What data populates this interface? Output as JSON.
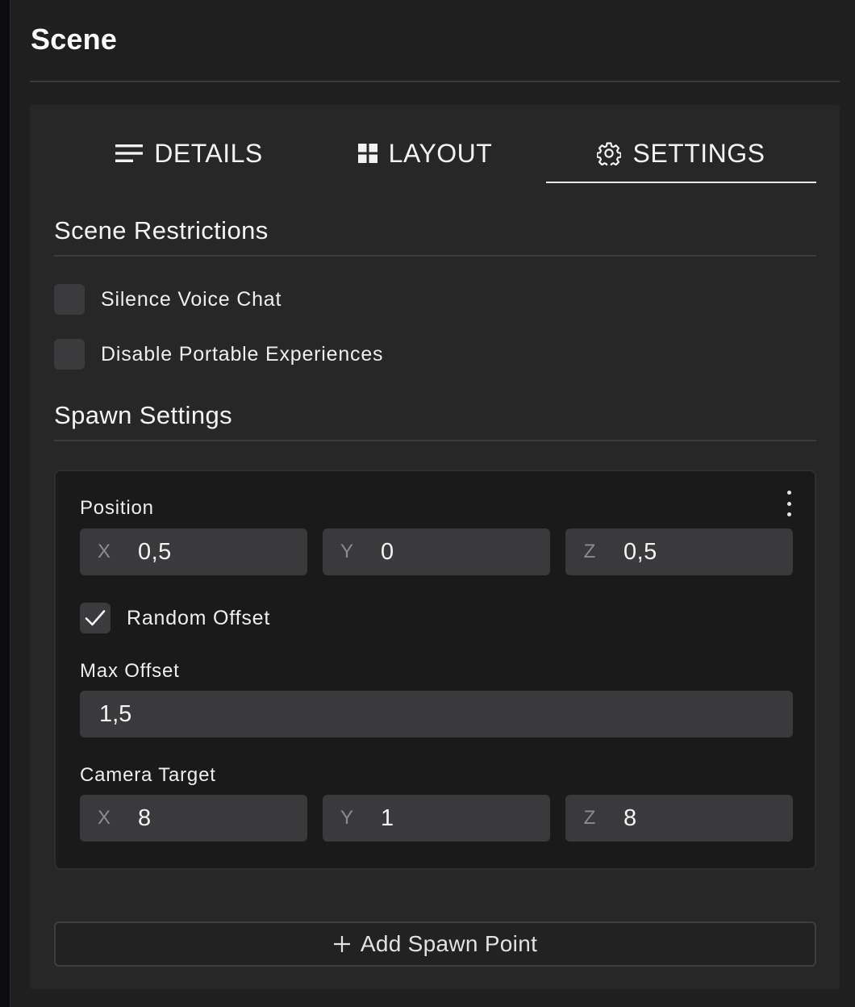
{
  "panel": {
    "title": "Scene"
  },
  "tabs": [
    {
      "label": "DETAILS",
      "icon": "lines-icon"
    },
    {
      "label": "LAYOUT",
      "icon": "grid-icon"
    },
    {
      "label": "SETTINGS",
      "icon": "gear-icon",
      "active": true
    }
  ],
  "restrictions": {
    "title": "Scene Restrictions",
    "items": [
      {
        "label": "Silence Voice Chat",
        "checked": false
      },
      {
        "label": "Disable Portable Experiences",
        "checked": false
      }
    ]
  },
  "spawn": {
    "title": "Spawn Settings",
    "position": {
      "label": "Position",
      "x_axis": "X",
      "x": "0,5",
      "y_axis": "Y",
      "y": "0",
      "z_axis": "Z",
      "z": "0,5"
    },
    "random_offset": {
      "label": "Random Offset",
      "checked": true
    },
    "max_offset": {
      "label": "Max Offset",
      "value": "1,5"
    },
    "camera_target": {
      "label": "Camera Target",
      "x_axis": "X",
      "x": "8",
      "y_axis": "Y",
      "y": "1",
      "z_axis": "Z",
      "z": "8"
    },
    "add_button": "Add Spawn Point"
  },
  "colors": {
    "background": "#1f1f1f",
    "card": "#272727",
    "input": "#3a3a3c",
    "text": "#f0f0f0"
  }
}
